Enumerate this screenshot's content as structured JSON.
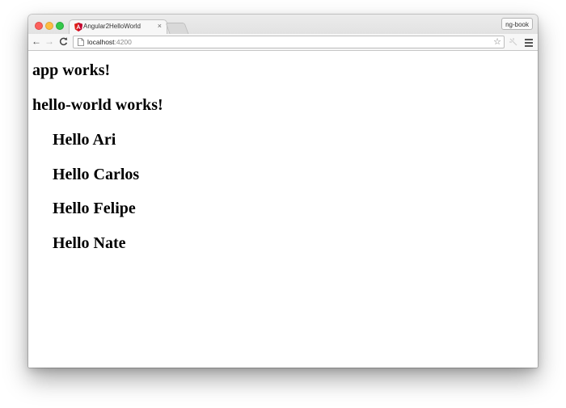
{
  "tab": {
    "title": "Angular2HelloWorld",
    "close_glyph": "×",
    "favicon": "angular-icon",
    "favicon_color": "#dd1b16"
  },
  "toolbar": {
    "back_glyph": "←",
    "forward_glyph": "→",
    "reload_glyph": "C",
    "star_glyph": "☆"
  },
  "omnibox": {
    "host": "localhost",
    "port": ":4200"
  },
  "profile_button": "ng-book",
  "page": {
    "app_heading": "app works!",
    "hello_world_heading": "hello-world works!",
    "greetings": [
      "Hello Ari",
      "Hello Carlos",
      "Hello Felipe",
      "Hello Nate"
    ]
  }
}
